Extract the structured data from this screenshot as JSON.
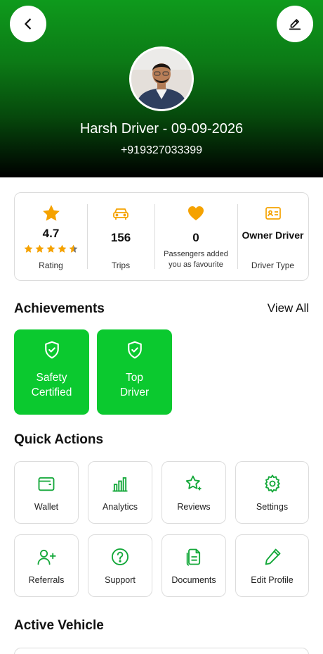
{
  "header": {
    "driver_name": "Harsh Driver - 09-09-2026",
    "phone": "+919327033399"
  },
  "stats": {
    "rating": {
      "value": "4.7",
      "label": "Rating",
      "stars_filled_fraction": 0.94
    },
    "trips": {
      "value": "156",
      "label": "Trips"
    },
    "favourites": {
      "value": "0",
      "label_line1": "Passengers added",
      "label_line2": "you as favourite"
    },
    "driver_type": {
      "value": "Owner Driver",
      "label": "Driver Type"
    }
  },
  "achievements": {
    "title": "Achievements",
    "view_all": "View All",
    "badges": [
      {
        "line1": "Safety",
        "line2": "Certified",
        "icon": "shield-check-icon"
      },
      {
        "line1": "Top",
        "line2": "Driver",
        "icon": "shield-check-icon"
      }
    ]
  },
  "quick_actions": {
    "title": "Quick Actions",
    "items": [
      {
        "label": "Wallet",
        "icon": "wallet-icon"
      },
      {
        "label": "Analytics",
        "icon": "bar-chart-icon"
      },
      {
        "label": "Reviews",
        "icon": "star-sparkle-icon"
      },
      {
        "label": "Settings",
        "icon": "gear-icon"
      },
      {
        "label": "Referrals",
        "icon": "user-plus-icon"
      },
      {
        "label": "Support",
        "icon": "help-circle-icon"
      },
      {
        "label": "Documents",
        "icon": "documents-icon"
      },
      {
        "label": "Edit Profile",
        "icon": "pencil-icon"
      }
    ]
  },
  "active_vehicle": {
    "title": "Active Vehicle"
  },
  "colors": {
    "brand_green": "#0bc92f",
    "icon_green": "#14a83a",
    "star_orange": "#f5a200",
    "heart_orange": "#f5a200"
  }
}
